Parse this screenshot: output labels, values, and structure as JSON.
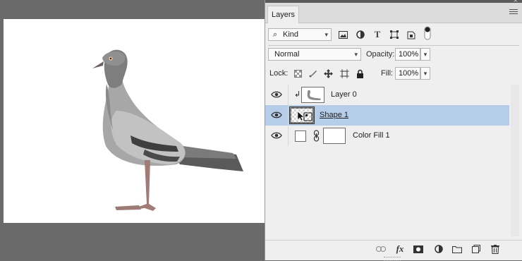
{
  "panel": {
    "tab_label": "Layers",
    "close_glyph": "×"
  },
  "filter": {
    "kind_label": "Kind",
    "icons": [
      "image-filter-icon",
      "adjustment-filter-icon",
      "type-filter-icon",
      "shape-filter-icon",
      "smart-object-filter-icon",
      "filter-toggle-icon"
    ]
  },
  "blend": {
    "mode_value": "Normal",
    "opacity_label": "Opacity:",
    "opacity_value": "100%"
  },
  "lock": {
    "lock_label": "Lock:",
    "icons": [
      "lock-transparent-icon",
      "lock-image-icon",
      "lock-position-icon",
      "lock-artboard-icon",
      "lock-all-icon"
    ],
    "fill_label": "Fill:",
    "fill_value": "100%"
  },
  "layers": [
    {
      "name": "Layer 0",
      "visible": true,
      "selected": false,
      "clipped": true
    },
    {
      "name": "Shape 1",
      "visible": true,
      "selected": true,
      "clipped": false
    },
    {
      "name": "Color Fill 1",
      "visible": true,
      "selected": false,
      "clipped": false
    }
  ],
  "bottom_icons": [
    "link-layers-icon",
    "fx-icon",
    "add-mask-icon",
    "adjustment-layer-icon",
    "new-group-icon",
    "new-layer-icon",
    "delete-icon"
  ],
  "bottom_labels": {
    "fx": "fx"
  },
  "colors": {
    "selection": "#b5cde9",
    "panel": "#efefef",
    "workspace": "#6a6a6a"
  }
}
